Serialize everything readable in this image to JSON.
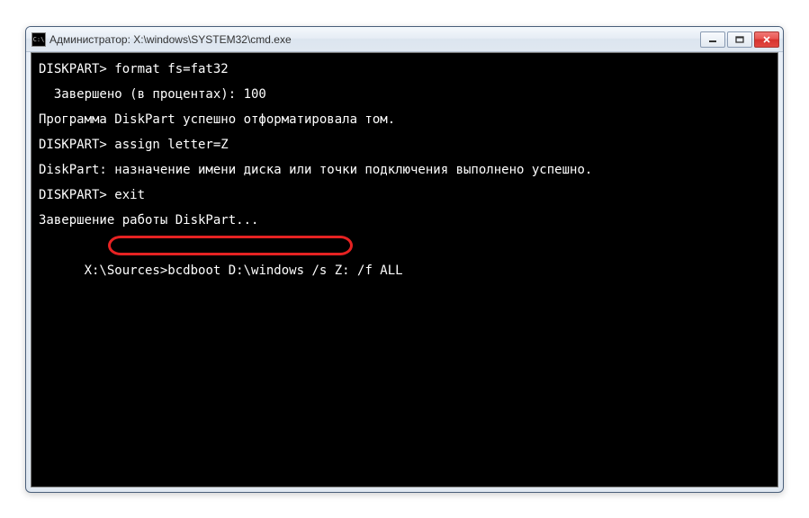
{
  "window": {
    "title": "Администратор: X:\\windows\\SYSTEM32\\cmd.exe",
    "icon_label": "C:\\"
  },
  "controls": {
    "minimize": "minimize",
    "maximize": "maximize",
    "close": "close"
  },
  "console": {
    "lines": [
      "DISKPART> format fs=fat32",
      "",
      "  Завершено (в процентах): 100",
      "",
      "Программа DiskPart успешно отформатировала том.",
      "",
      "DISKPART> assign letter=Z",
      "",
      "DiskPart: назначение имени диска или точки подключения выполнено успешно.",
      "",
      "DISKPART> exit",
      "",
      "Завершение работы DiskPart...",
      "",
      "X:\\Sources>bcdboot D:\\windows /s Z: /f ALL"
    ],
    "highlighted_command": "bcdboot D:\\windows /s Z: /f ALL",
    "current_prompt": "X:\\Sources>"
  }
}
